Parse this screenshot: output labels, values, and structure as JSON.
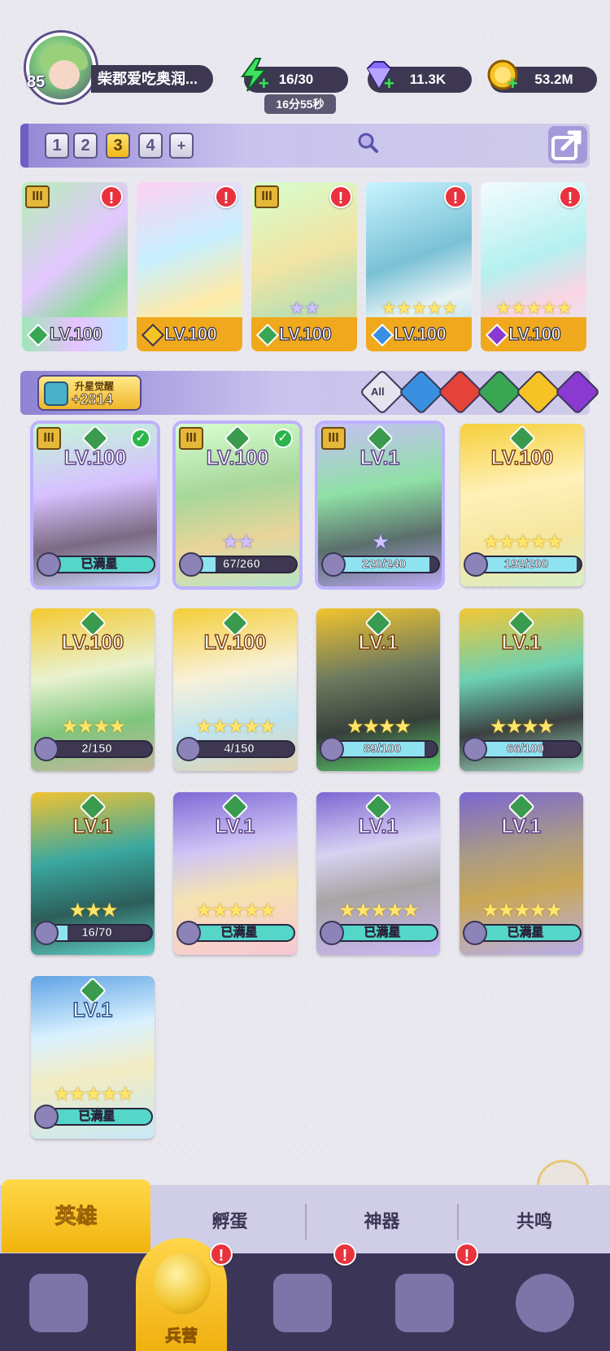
{
  "player": {
    "level": "85",
    "name": "柴郡爱吃奥润..."
  },
  "resources": {
    "energy": "16/30",
    "energy_timer": "16分55秒",
    "gems": "11.3K",
    "gold": "53.2M",
    "plus": "+"
  },
  "team_slots": [
    "1",
    "2",
    "3",
    "4",
    "+"
  ],
  "team_active_slot": "3",
  "team_heroes": [
    {
      "level": "LV.100",
      "tier": "III"
    },
    {
      "level": "LV.100"
    },
    {
      "level": "LV.100",
      "tier": "III"
    },
    {
      "level": "LV.100"
    },
    {
      "level": "LV.100"
    }
  ],
  "alert_mark": "!",
  "awaken": {
    "label": "升星觉醒",
    "value": "+2814"
  },
  "filters": {
    "all": "All"
  },
  "heroes": [
    {
      "level": "LV.100",
      "progress": "已满星",
      "tier": "III"
    },
    {
      "level": "LV.100",
      "progress": "67/260",
      "tier": "III"
    },
    {
      "level": "LV.1",
      "progress": "220/240",
      "tier": "III"
    },
    {
      "level": "LV.100",
      "progress": "192/200"
    },
    {
      "level": "LV.100",
      "progress": "2/150"
    },
    {
      "level": "LV.100",
      "progress": "4/150"
    },
    {
      "level": "LV.1",
      "progress": "89/100"
    },
    {
      "level": "LV.1",
      "progress": "66/100"
    },
    {
      "level": "LV.1",
      "progress": "16/70"
    },
    {
      "level": "LV.1",
      "progress": "已满星"
    },
    {
      "level": "LV.1",
      "progress": "已满星"
    },
    {
      "level": "LV.1",
      "progress": "已满星"
    },
    {
      "level": "LV.1",
      "progress": "已满星"
    }
  ],
  "sub_tabs": [
    "英雄",
    "孵蛋",
    "神器",
    "共鸣"
  ],
  "nav": {
    "active_label": "兵营"
  }
}
